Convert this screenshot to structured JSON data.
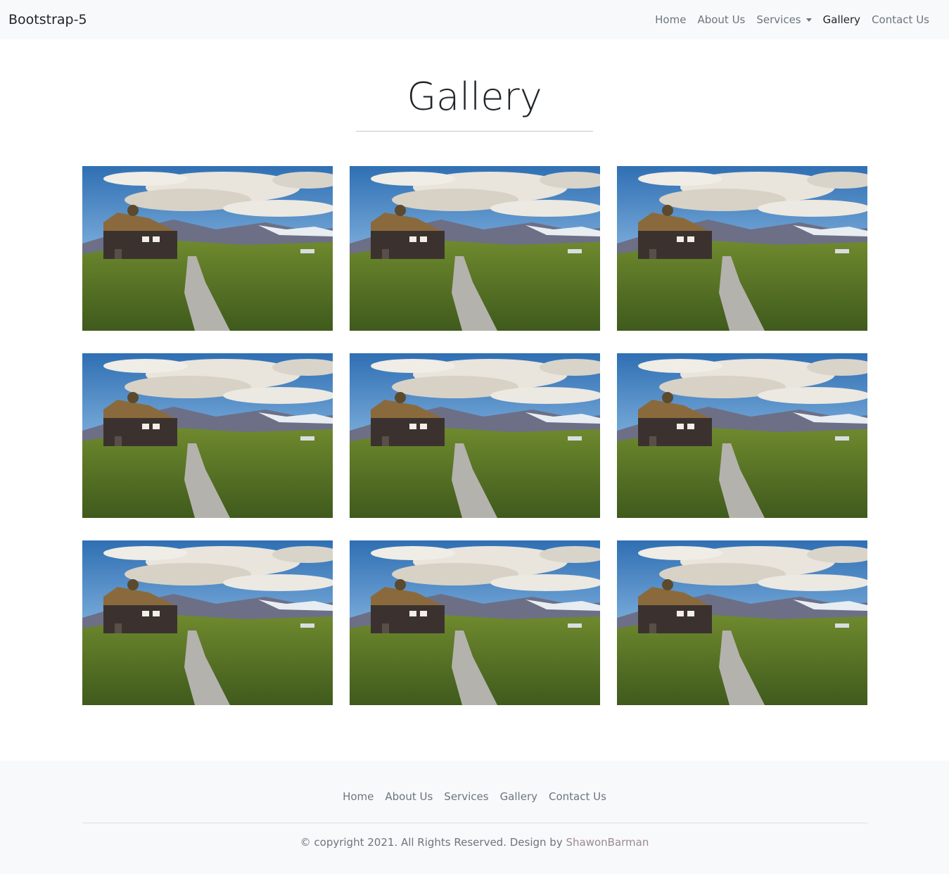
{
  "navbar": {
    "brand": "Bootstrap-5",
    "links": [
      "Home",
      "About Us",
      "Services",
      "Gallery",
      "Contact Us"
    ],
    "active": "Gallery"
  },
  "page": {
    "title": "Gallery"
  },
  "gallery": {
    "image_count": 9,
    "image_subject": "cabin-landscape"
  },
  "footer": {
    "links": [
      "Home",
      "About Us",
      "Services",
      "Gallery",
      "Contact Us"
    ],
    "copyright_text": "© copyright 2021. All Rights Reserved. Design by",
    "designer": "ShawonBarman"
  },
  "colors": {
    "navbar_bg": "#f8f9fa",
    "link": "#6c757d",
    "active_link": "#212529",
    "designer_link": "#9b8a8f"
  }
}
